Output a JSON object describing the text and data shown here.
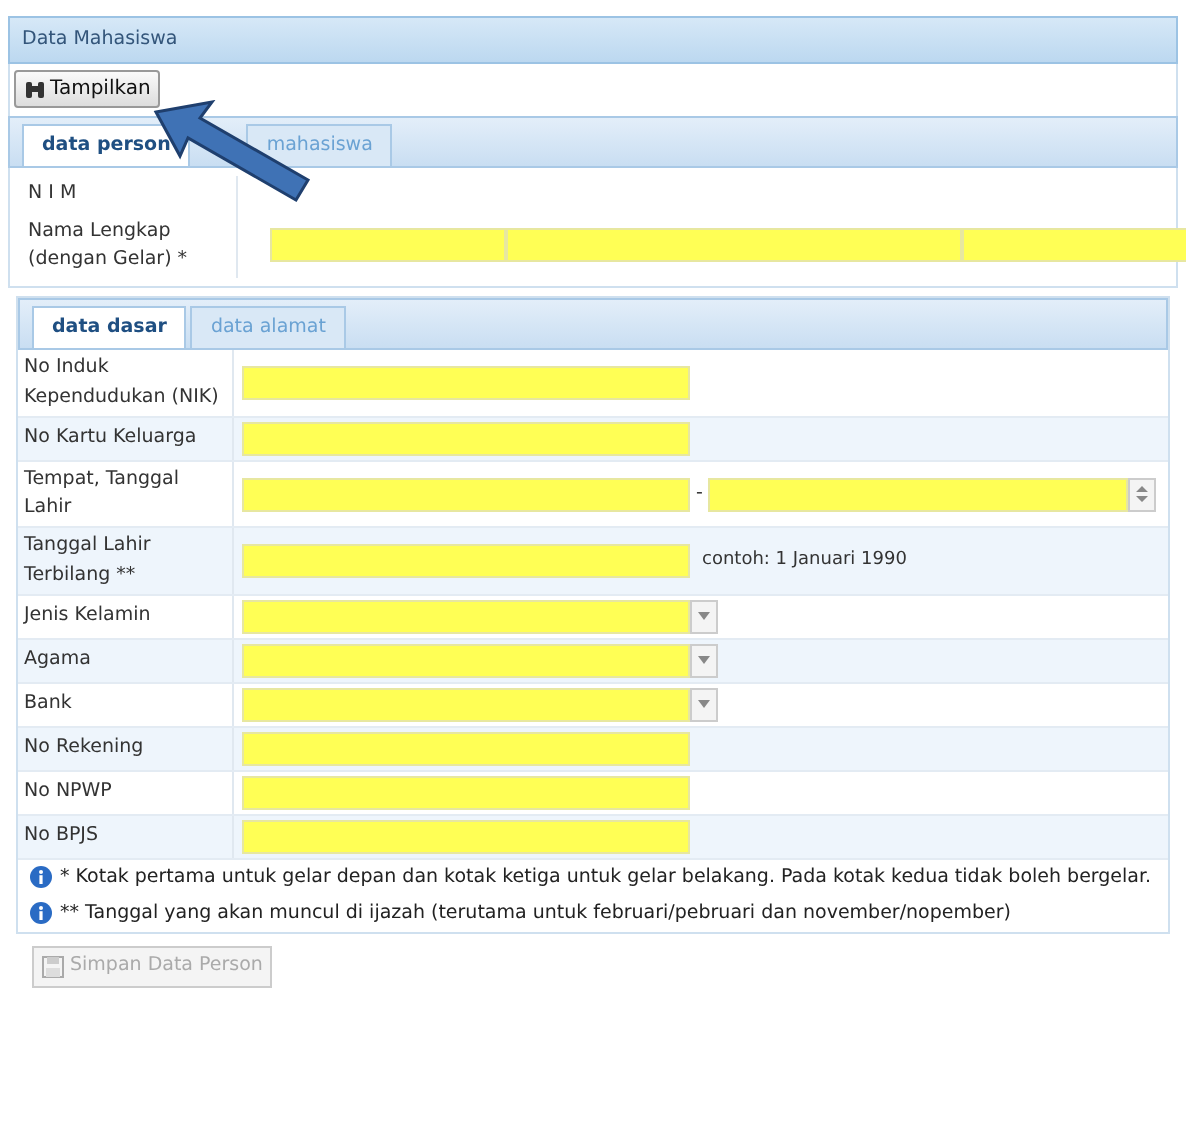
{
  "title": "Data Mahasiswa",
  "toolbar": {
    "button": "Tampilkan"
  },
  "outer_tabs": [
    {
      "label": "data person",
      "selected": true
    },
    {
      "label": "mahasiswa",
      "selected": false
    }
  ],
  "header_fields": [
    {
      "label": "N I M",
      "kind": "empty"
    },
    {
      "label": "Nama Lengkap (dengan Gelar) *",
      "kind": "triple"
    }
  ],
  "inner_tabs": [
    {
      "label": "data dasar",
      "selected": true
    },
    {
      "label": "data alamat",
      "selected": false
    }
  ],
  "fields": [
    {
      "label": "No Induk Kependudukan (NIK)",
      "kind": "text"
    },
    {
      "label": "No Kartu Keluarga",
      "kind": "text"
    },
    {
      "label": "Tempat, Tanggal Lahir",
      "kind": "date_pair",
      "separator": "-"
    },
    {
      "label": "Tanggal Lahir Terbilang **",
      "kind": "text",
      "hint": "contoh: 1 Januari 1990"
    },
    {
      "label": "Jenis Kelamin",
      "kind": "select"
    },
    {
      "label": "Agama",
      "kind": "select"
    },
    {
      "label": "Bank",
      "kind": "select"
    },
    {
      "label": "No Rekening",
      "kind": "text"
    },
    {
      "label": "No NPWP",
      "kind": "text"
    },
    {
      "label": "No BPJS",
      "kind": "text"
    }
  ],
  "notes": [
    "* Kotak pertama untuk gelar depan dan kotak ketiga untuk gelar belakang. Pada kotak kedua tidak boleh bergelar.",
    "** Tanggal yang akan muncul di ijazah (terutama untuk februari/pebruari dan november/nopember)"
  ],
  "save_button": {
    "label": "Simpan Data Person",
    "disabled": true
  }
}
